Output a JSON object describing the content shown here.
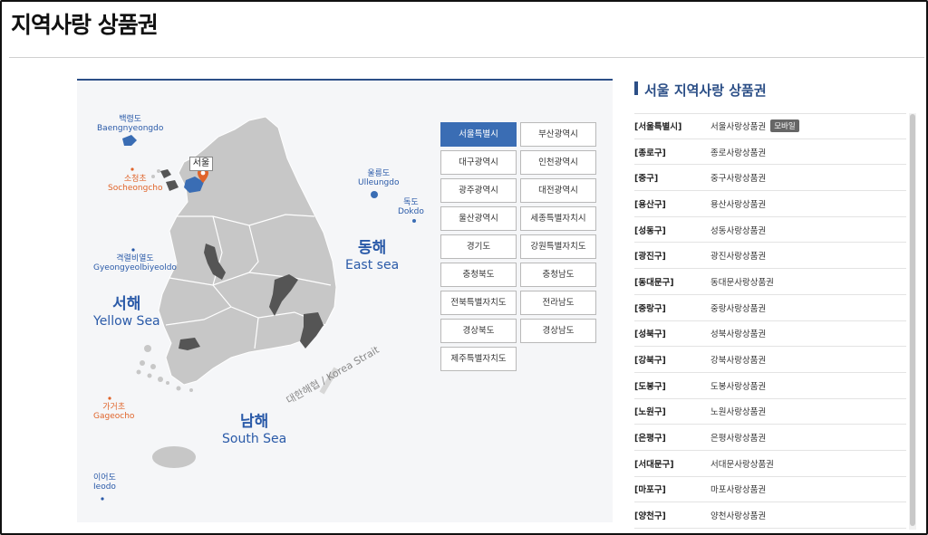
{
  "page": {
    "title": "지역사랑 상품권"
  },
  "map": {
    "seas": {
      "west": {
        "kr": "서해",
        "en": "Yellow Sea"
      },
      "east": {
        "kr": "동해",
        "en": "East sea"
      },
      "south": {
        "kr": "남해",
        "en": "South Sea"
      }
    },
    "islands": {
      "baengnyeongdo": {
        "kr": "백령도",
        "en": "Baengnyeongdo"
      },
      "socheongcho": {
        "kr": "소청초",
        "en": "Socheongcho"
      },
      "gyeongyeolbiyeoldo": {
        "kr": "격렬비열도",
        "en": "Gyeongyeolbiyeoldo"
      },
      "gageocho": {
        "kr": "가거초",
        "en": "Gageocho"
      },
      "ieodo": {
        "kr": "이어도",
        "en": "Ieodo"
      },
      "ulleungdo": {
        "kr": "울릉도",
        "en": "Ulleungdo"
      },
      "dokdo": {
        "kr": "독도",
        "en": "Dokdo"
      }
    },
    "strait_label": "대한해협 / Korea Strait",
    "seoul_pin": "서울",
    "colors": {
      "land": "#c7c7c7",
      "highlight": "#555555",
      "seoul": "#3a6db4",
      "pin": "#e0642a",
      "sea_text": "#2a5aa8",
      "orange_text": "#e0642a"
    }
  },
  "regions": [
    {
      "label": "서울특별시",
      "active": true
    },
    {
      "label": "부산광역시",
      "active": false
    },
    {
      "label": "대구광역시",
      "active": false
    },
    {
      "label": "인천광역시",
      "active": false
    },
    {
      "label": "광주광역시",
      "active": false
    },
    {
      "label": "대전광역시",
      "active": false
    },
    {
      "label": "울산광역시",
      "active": false
    },
    {
      "label": "세종특별자치시",
      "active": false
    },
    {
      "label": "경기도",
      "active": false
    },
    {
      "label": "강원특별자치도",
      "active": false
    },
    {
      "label": "충청북도",
      "active": false
    },
    {
      "label": "충청남도",
      "active": false
    },
    {
      "label": "전북특별자치도",
      "active": false
    },
    {
      "label": "전라남도",
      "active": false
    },
    {
      "label": "경상북도",
      "active": false
    },
    {
      "label": "경상남도",
      "active": false
    },
    {
      "label": "제주특별자치도",
      "active": false
    }
  ],
  "side": {
    "title": "서울 지역사랑 상품권",
    "mobile_badge": "모바일",
    "rows": [
      {
        "district": "[서울특별시]",
        "voucher": "서울사랑상품권",
        "mobile": true
      },
      {
        "district": "[종로구]",
        "voucher": "종로사랑상품권"
      },
      {
        "district": "[중구]",
        "voucher": "중구사랑상품권"
      },
      {
        "district": "[용산구]",
        "voucher": "용산사랑상품권"
      },
      {
        "district": "[성동구]",
        "voucher": "성동사랑상품권"
      },
      {
        "district": "[광진구]",
        "voucher": "광진사랑상품권"
      },
      {
        "district": "[동대문구]",
        "voucher": "동대문사랑상품권"
      },
      {
        "district": "[중랑구]",
        "voucher": "중랑사랑상품권"
      },
      {
        "district": "[성북구]",
        "voucher": "성북사랑상품권"
      },
      {
        "district": "[강북구]",
        "voucher": "강북사랑상품권"
      },
      {
        "district": "[도봉구]",
        "voucher": "도봉사랑상품권"
      },
      {
        "district": "[노원구]",
        "voucher": "노원사랑상품권"
      },
      {
        "district": "[은평구]",
        "voucher": "은평사랑상품권"
      },
      {
        "district": "[서대문구]",
        "voucher": "서대문사랑상품권"
      },
      {
        "district": "[마포구]",
        "voucher": "마포사랑상품권"
      },
      {
        "district": "[양천구]",
        "voucher": "양천사랑상품권"
      }
    ]
  }
}
